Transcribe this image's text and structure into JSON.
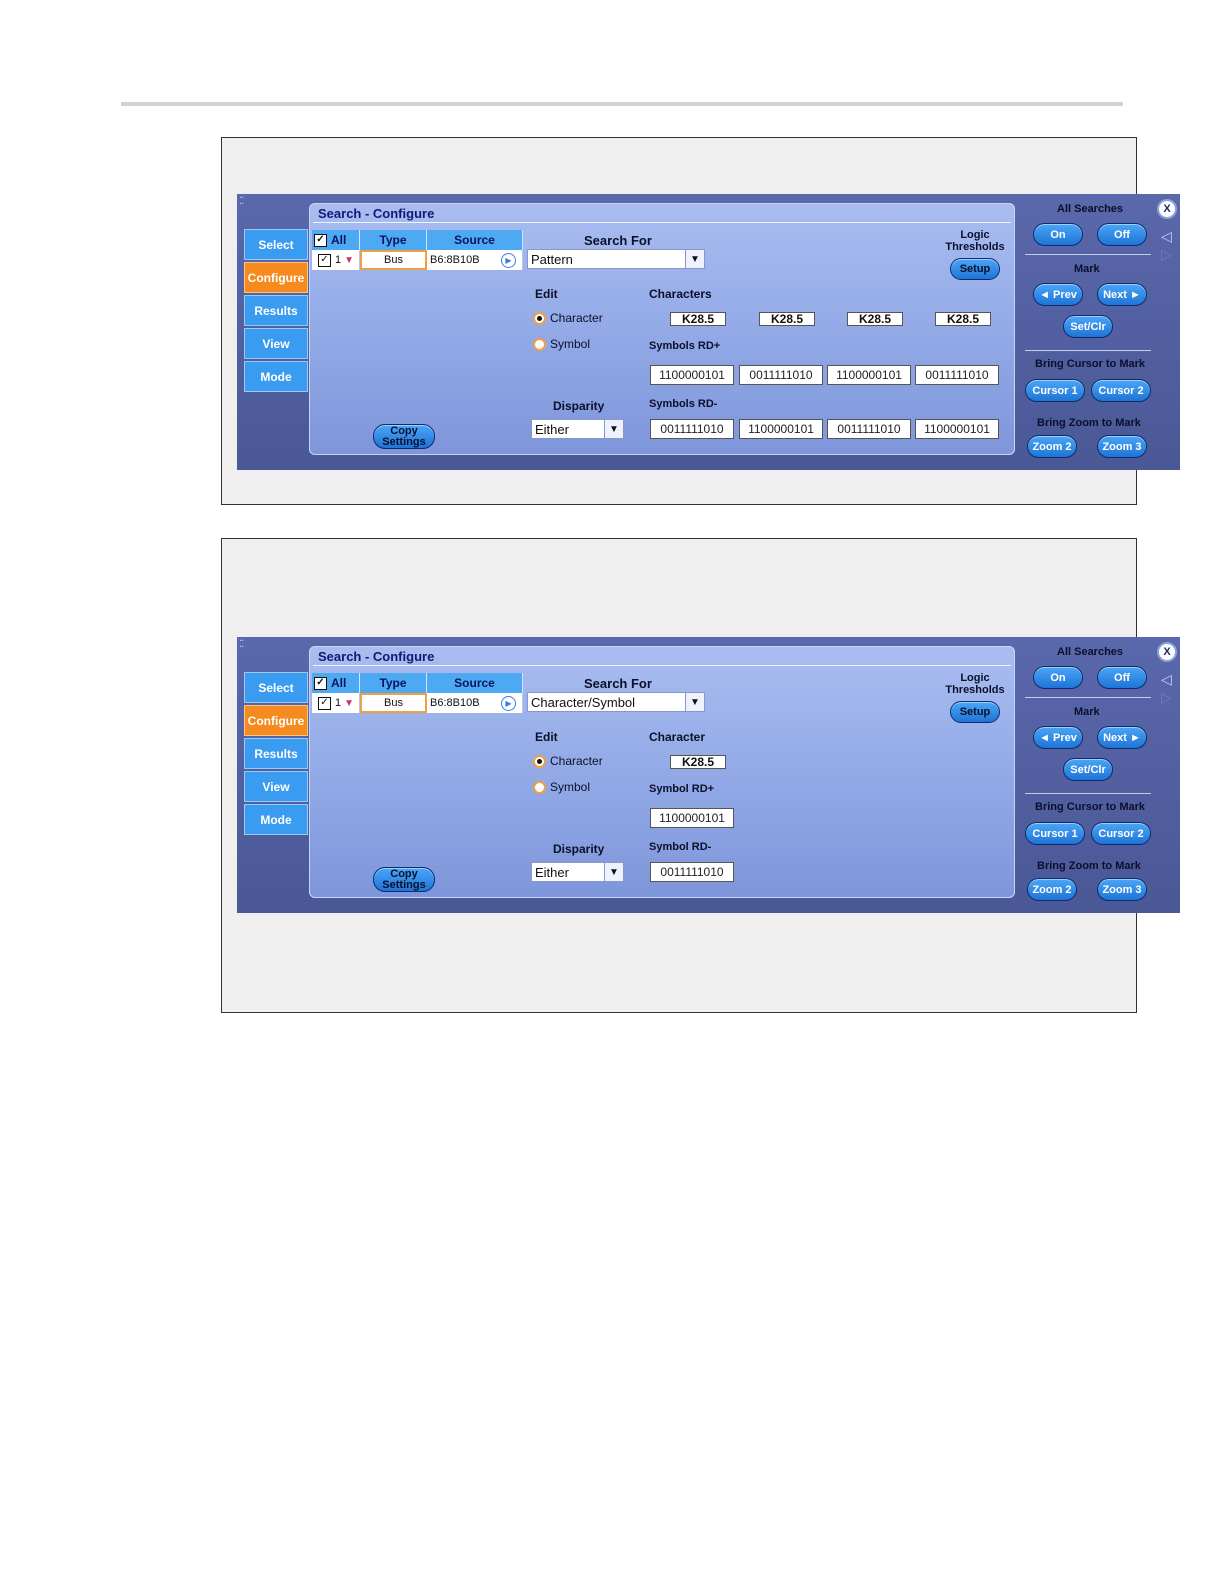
{
  "screens": [
    {
      "panel_title": "Search - Configure",
      "tabs": [
        "Select",
        "Configure",
        "Results",
        "View",
        "Mode"
      ],
      "active_tab": "Configure",
      "source_table": {
        "headers": {
          "all": "All",
          "type": "Type",
          "source": "Source"
        },
        "row": {
          "index": "1",
          "type": "Bus",
          "source": "B6:8B10B"
        }
      },
      "search_for": {
        "label": "Search For",
        "value": "Pattern"
      },
      "edit": {
        "label": "Edit",
        "options": [
          "Character",
          "Symbol"
        ],
        "selected": "Character"
      },
      "disparity": {
        "label": "Disparity",
        "value": "Either"
      },
      "copy_settings": {
        "line1": "Copy",
        "line2": "Settings"
      },
      "logic_thresholds": {
        "line1": "Logic",
        "line2": "Thresholds",
        "button": "Setup"
      },
      "characters_label": "Characters",
      "characters": [
        "K28.5",
        "K28.5",
        "K28.5",
        "K28.5"
      ],
      "rd_plus_label": "Symbols RD+",
      "rd_plus": [
        "1100000101",
        "0011111010",
        "1100000101",
        "0011111010"
      ],
      "rd_minus_label": "Symbols RD-",
      "rd_minus": [
        "0011111010",
        "1100000101",
        "0011111010",
        "1100000101"
      ],
      "right": {
        "all_searches": "All Searches",
        "on": "On",
        "off": "Off",
        "mark": "Mark",
        "prev": "◄ Prev",
        "next": "Next ►",
        "setclr": "Set/Clr",
        "bring_cursor": "Bring Cursor to Mark",
        "cursor1": "Cursor 1",
        "cursor2": "Cursor 2",
        "bring_zoom": "Bring Zoom to Mark",
        "zoom2": "Zoom 2",
        "zoom3": "Zoom 3",
        "close": "X"
      }
    },
    {
      "panel_title": "Search - Configure",
      "tabs": [
        "Select",
        "Configure",
        "Results",
        "View",
        "Mode"
      ],
      "active_tab": "Configure",
      "source_table": {
        "headers": {
          "all": "All",
          "type": "Type",
          "source": "Source"
        },
        "row": {
          "index": "1",
          "type": "Bus",
          "source": "B6:8B10B"
        }
      },
      "search_for": {
        "label": "Search For",
        "value": "Character/Symbol"
      },
      "edit": {
        "label": "Edit",
        "options": [
          "Character",
          "Symbol"
        ],
        "selected": "Character"
      },
      "disparity": {
        "label": "Disparity",
        "value": "Either"
      },
      "copy_settings": {
        "line1": "Copy",
        "line2": "Settings"
      },
      "logic_thresholds": {
        "line1": "Logic",
        "line2": "Thresholds",
        "button": "Setup"
      },
      "characters_label": "Character",
      "characters": [
        "K28.5"
      ],
      "rd_plus_label": "Symbol RD+",
      "rd_plus": [
        "1100000101"
      ],
      "rd_minus_label": "Symbol RD-",
      "rd_minus": [
        "0011111010"
      ],
      "right": {
        "all_searches": "All Searches",
        "on": "On",
        "off": "Off",
        "mark": "Mark",
        "prev": "◄ Prev",
        "next": "Next ►",
        "setclr": "Set/Clr",
        "bring_cursor": "Bring Cursor to Mark",
        "cursor1": "Cursor 1",
        "cursor2": "Cursor 2",
        "bring_zoom": "Bring Zoom to Mark",
        "zoom2": "Zoom 2",
        "zoom3": "Zoom 3",
        "close": "X"
      }
    }
  ]
}
